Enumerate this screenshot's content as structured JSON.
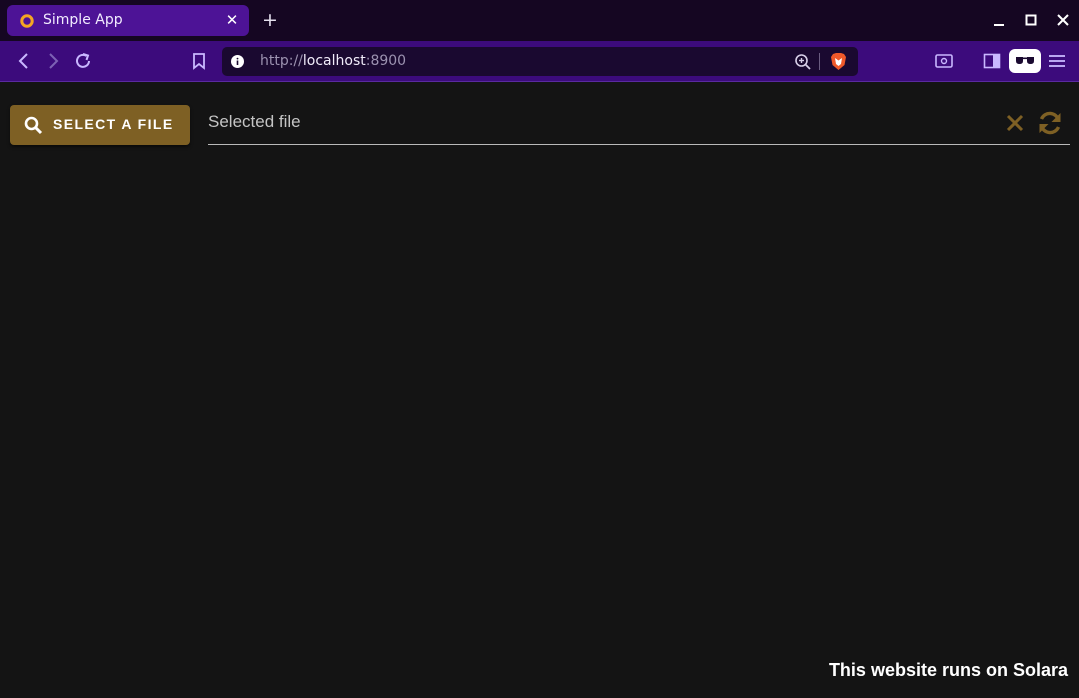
{
  "browser": {
    "tab": {
      "title": "Simple App",
      "favicon": "solara-favicon-icon",
      "close_icon": "close-icon"
    },
    "new_tab_label": "+",
    "window_controls": [
      "minimize-icon",
      "maximize-icon",
      "close-window-icon"
    ],
    "toolbar": {
      "back_icon": "chevron-left-icon",
      "forward_icon": "chevron-right-icon",
      "reload_icon": "reload-icon",
      "bookmark_icon": "bookmark-icon",
      "url": {
        "scheme": "http://",
        "host": "localhost",
        "port": ":8900"
      },
      "zoom_icon": "zoom-in-icon",
      "brave_icon": "brave-shield-icon",
      "right_icons": [
        "screenshot-icon",
        "sidebar-icon",
        "extension-icon",
        "menu-icon"
      ]
    },
    "colors": {
      "titlebar": "#150622",
      "tab": "#4d1396",
      "toolbar": "#3c0b7c",
      "urlbar": "#1a0930"
    }
  },
  "app": {
    "select_button": {
      "label": "SELECT A FILE",
      "icon": "search-icon"
    },
    "file_field": {
      "placeholder": "Selected file"
    },
    "clear_icon": "close-icon",
    "refresh_icon": "refresh-icon",
    "footer": "This website runs on Solara",
    "colors": {
      "accent": "#7e6024",
      "icon_accent": "#7e6024",
      "background": "#141414"
    }
  }
}
